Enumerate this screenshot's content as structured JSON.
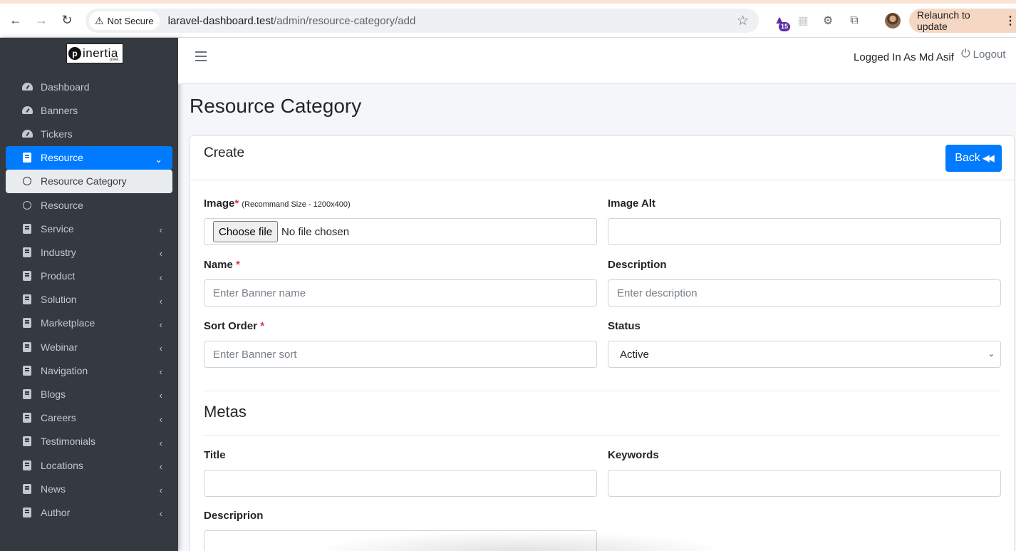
{
  "browser": {
    "security_label": "Not Secure",
    "url_host": "laravel-dashboard.test",
    "url_path": "/admin/resource-category/add",
    "extension_badge": "15",
    "relaunch_label": "Relaunch to update"
  },
  "brand": {
    "name": "inertia",
    "sub": "pixel."
  },
  "sidebar": {
    "items": [
      {
        "label": "Dashboard",
        "icon": "gauge"
      },
      {
        "label": "Banners",
        "icon": "gauge"
      },
      {
        "label": "Tickers",
        "icon": "gauge"
      },
      {
        "label": "Resource",
        "icon": "book",
        "expanded": true
      },
      {
        "label": "Resource Category",
        "icon": "circle"
      },
      {
        "label": "Resource",
        "icon": "circle"
      },
      {
        "label": "Service",
        "icon": "book"
      },
      {
        "label": "Industry",
        "icon": "book"
      },
      {
        "label": "Product",
        "icon": "book"
      },
      {
        "label": "Solution",
        "icon": "book"
      },
      {
        "label": "Marketplace",
        "icon": "book"
      },
      {
        "label": "Webinar",
        "icon": "book"
      },
      {
        "label": "Navigation",
        "icon": "book"
      },
      {
        "label": "Blogs",
        "icon": "book"
      },
      {
        "label": "Careers",
        "icon": "book"
      },
      {
        "label": "Testimonials",
        "icon": "book"
      },
      {
        "label": "Locations",
        "icon": "book"
      },
      {
        "label": "News",
        "icon": "book"
      },
      {
        "label": "Author",
        "icon": "book"
      }
    ]
  },
  "navbar": {
    "logged_in": "Logged In As Md Asif",
    "logout": "Logout"
  },
  "page": {
    "title": "Resource Category"
  },
  "card": {
    "title": "Create",
    "back_label": "Back"
  },
  "form": {
    "image_label": "Image",
    "image_hint": "(Recommand Size - 1200x400)",
    "choose_file": "Choose file",
    "no_file": "No file chosen",
    "image_alt_label": "Image Alt",
    "image_alt_value": "",
    "name_label": "Name",
    "name_placeholder": "Enter Banner name",
    "description_label": "Description",
    "description_placeholder": "Enter description",
    "sort_label": "Sort Order",
    "sort_placeholder": "Enter Banner sort",
    "status_label": "Status",
    "status_value": "Active",
    "required_mark": "*"
  },
  "metas": {
    "title": "Metas",
    "meta_title_label": "Title",
    "keywords_label": "Keywords",
    "description_label": "Descriprion"
  },
  "colors": {
    "sidebar_bg": "#343a40",
    "accent": "#007bff",
    "required": "#dc3545"
  }
}
